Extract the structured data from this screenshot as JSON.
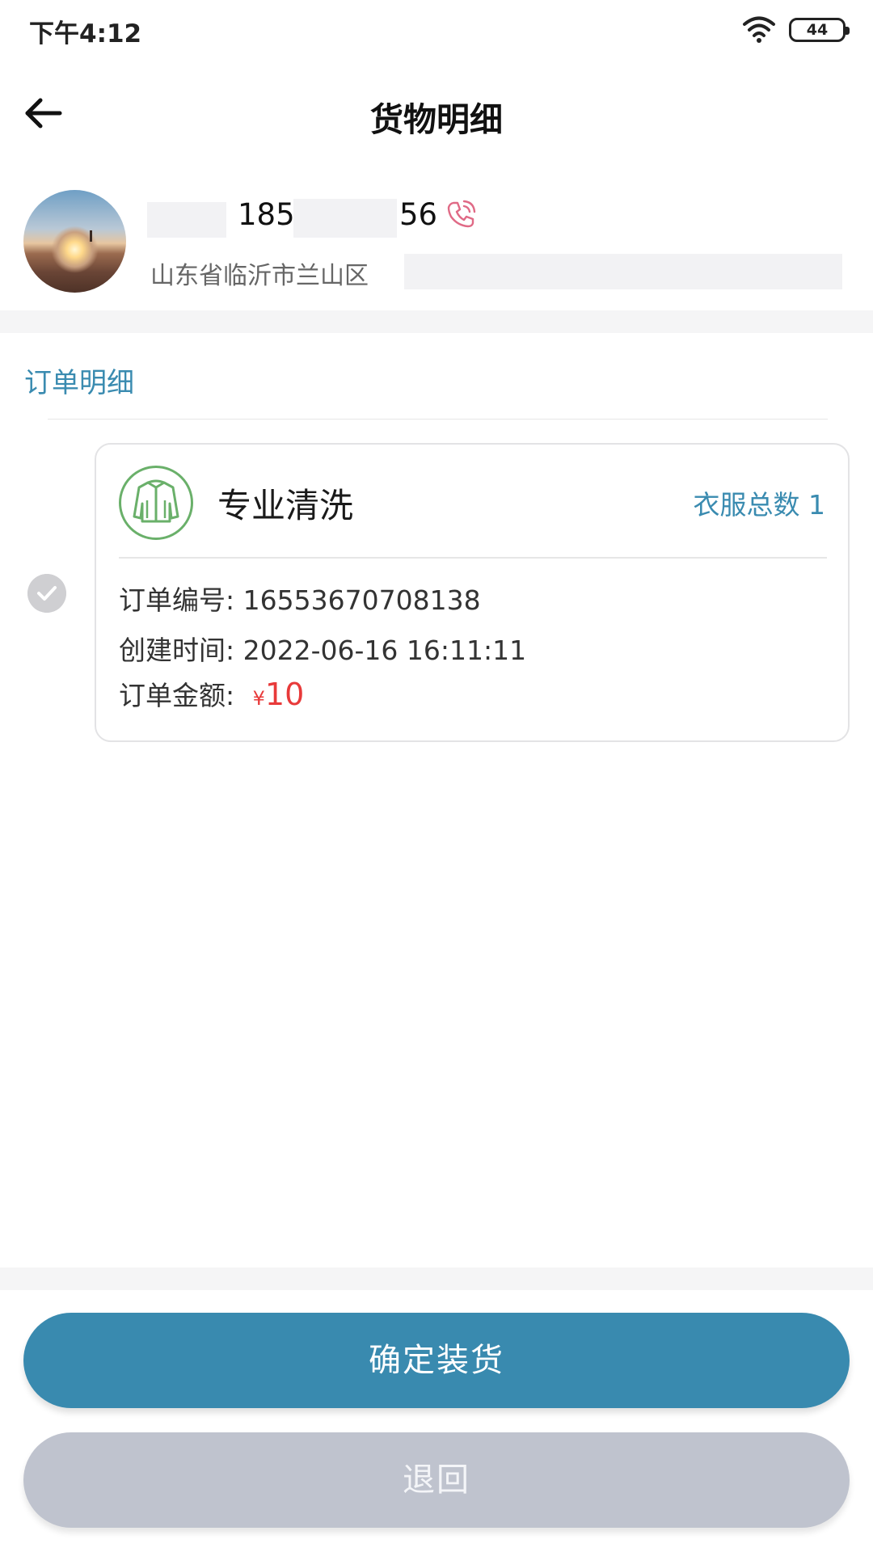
{
  "status_bar": {
    "time": "下午4:12",
    "battery": "44",
    "icons": [
      "wifi-icon",
      "battery-icon"
    ]
  },
  "header": {
    "back_icon": "arrow-left-icon",
    "title": "货物明细"
  },
  "customer": {
    "avatar": "avatar",
    "phone_prefix": "185",
    "phone_suffix": "56",
    "call_icon": "phone-call-icon",
    "address": "山东省临沂市兰山区"
  },
  "orders_section": {
    "title": "订单明细",
    "orders": [
      {
        "service_icon": "jacket-icon",
        "service_name": "专业清洗",
        "garment_count_label": "衣服总数 1",
        "order_no_label": "订单编号:",
        "order_no": "16553670708138",
        "created_label": "创建时间:",
        "created_at": "2022-06-16 16:11:11",
        "amount_label": "订单金额:",
        "currency": "¥",
        "amount": "10",
        "selected": false
      }
    ]
  },
  "actions": {
    "confirm_label": "确定装货",
    "return_label": "退回"
  },
  "colors": {
    "accent": "#398aaf",
    "price": "#e83a3a",
    "disabled_button": "#bfc3ce",
    "service_icon_green": "#6ab06a"
  }
}
